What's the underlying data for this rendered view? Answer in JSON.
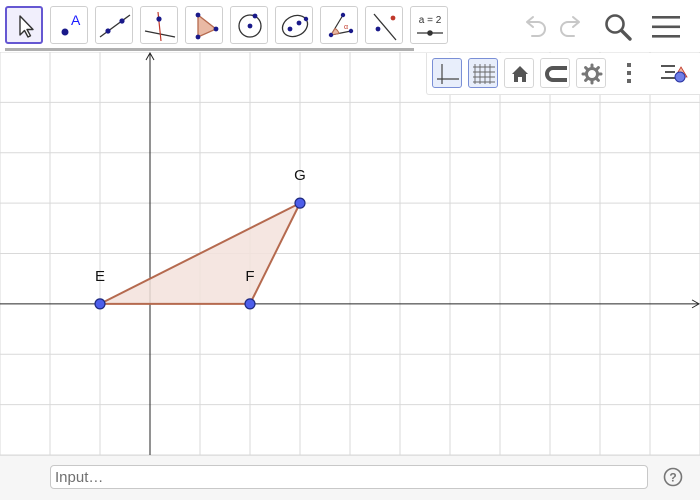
{
  "toolbar": {
    "tools": [
      {
        "id": "move",
        "icon": "cursor-arrow-icon",
        "selected": true
      },
      {
        "id": "point",
        "icon": "point-icon",
        "label": "A"
      },
      {
        "id": "line",
        "icon": "line-through-points-icon"
      },
      {
        "id": "perpendicular",
        "icon": "perpendicular-line-icon"
      },
      {
        "id": "polygon",
        "icon": "polygon-icon"
      },
      {
        "id": "circle",
        "icon": "circle-center-point-icon"
      },
      {
        "id": "conic",
        "icon": "ellipse-icon"
      },
      {
        "id": "angle",
        "icon": "angle-icon"
      },
      {
        "id": "reflect",
        "icon": "reflect-icon"
      },
      {
        "id": "slider",
        "icon": "slider-icon",
        "label": "a = 2"
      }
    ],
    "undo_icon": "undo-icon",
    "redo_icon": "redo-icon",
    "search_icon": "search-icon",
    "menu_icon": "hamburger-menu-icon"
  },
  "style_bar": {
    "buttons": [
      {
        "id": "axes",
        "icon": "axes-icon",
        "active": true
      },
      {
        "id": "grid",
        "icon": "grid-icon",
        "active": true
      },
      {
        "id": "home",
        "icon": "home-icon"
      },
      {
        "id": "point-capturing",
        "icon": "magnet-icon"
      },
      {
        "id": "settings",
        "icon": "gear-icon"
      },
      {
        "id": "more",
        "icon": "more-vertical-icon"
      },
      {
        "id": "algebra-toggle",
        "icon": "algebra-view-icon"
      }
    ]
  },
  "graphics": {
    "grid": true,
    "axes": true,
    "x_range": [
      -3,
      11
    ],
    "y_range": [
      -3,
      5
    ],
    "points": [
      {
        "name": "E",
        "x": -1,
        "y": 0
      },
      {
        "name": "F",
        "x": 2,
        "y": 0
      },
      {
        "name": "G",
        "x": 3,
        "y": 2
      }
    ],
    "polygon": [
      "E",
      "F",
      "G"
    ],
    "colors": {
      "grid": "#d9d9d9",
      "axis": "#262626",
      "polygon_stroke": "#b56a4f",
      "polygon_fill": "#f3e2dc",
      "point_fill": "#4d5eea",
      "point_stroke": "#1f2a80"
    }
  },
  "input_bar": {
    "placeholder": "Input…",
    "help_icon": "help-circle-icon"
  }
}
